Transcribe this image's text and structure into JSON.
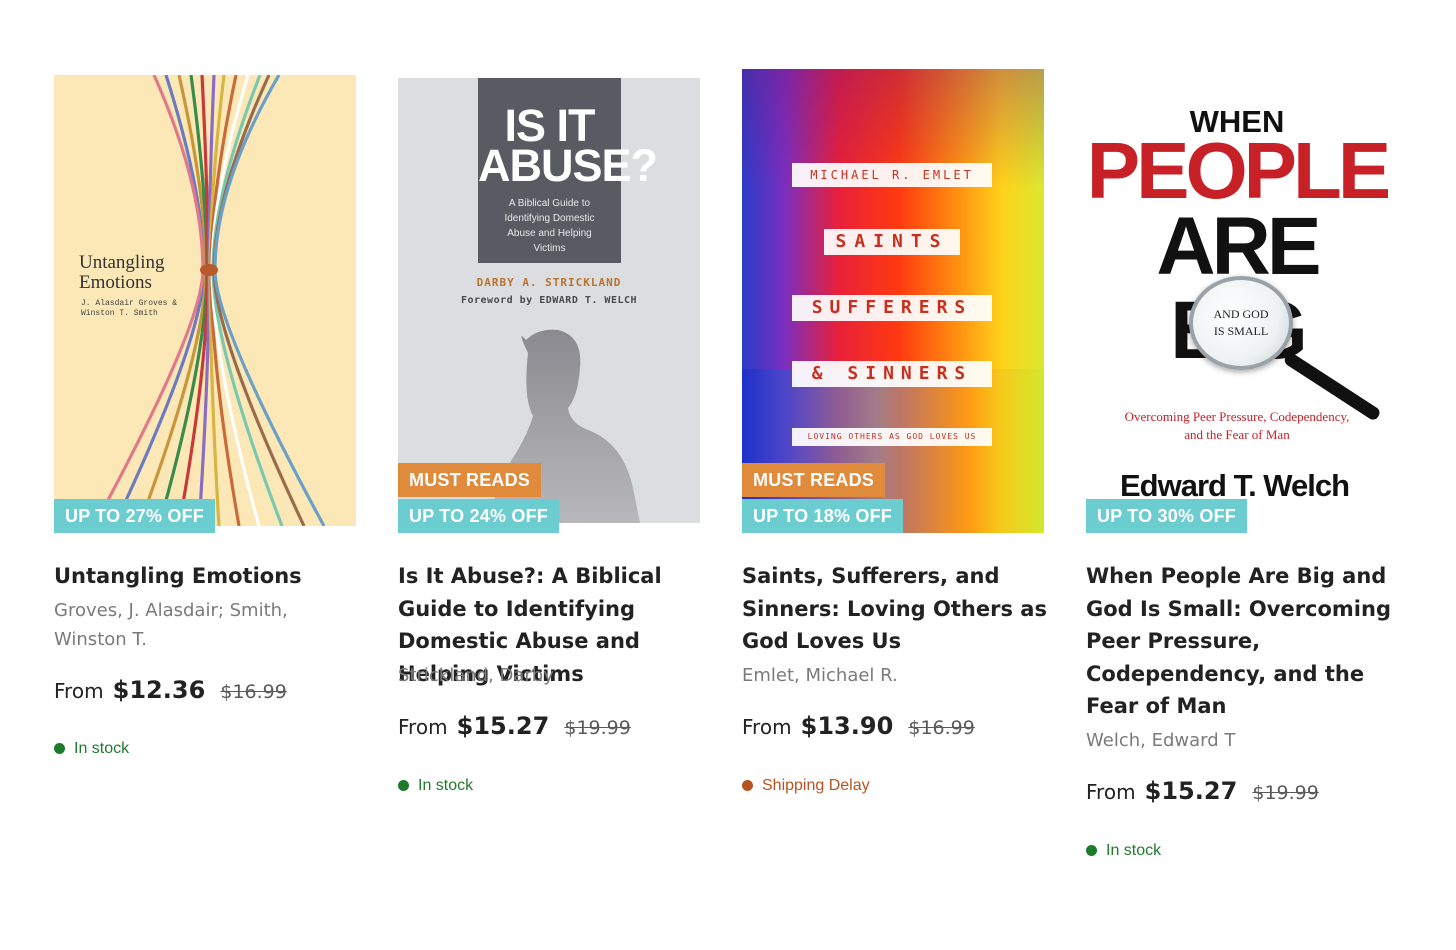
{
  "products": [
    {
      "title": "Untangling Emotions",
      "author": "Groves, J. Alasdair; Smith, Winston T.",
      "price_from": "From",
      "price": "$12.36",
      "price_was": "$16.99",
      "stock": "In stock",
      "stock_color": "#1f7a2e",
      "badge_off": "UP TO 27% OFF",
      "cover": {
        "title": "Untangling Emotions",
        "authors": "J. Alasdair Groves & Winston T. Smith",
        "bg": "#fce8b6"
      }
    },
    {
      "title": "Is It Abuse?: A Biblical Guide to Identifying Domestic Abuse and Helping Victims",
      "author": "Strickland, Darby",
      "price_from": "From",
      "price": "$15.27",
      "price_was": "$19.99",
      "stock": "In stock",
      "stock_color": "#1f7a2e",
      "badge_must": "MUST READS",
      "badge_off": "UP TO 24% OFF",
      "cover": {
        "title": "IS IT ABUSE?",
        "subtitle": "A Biblical Guide to Identifying Domestic Abuse and Helping Victims",
        "author": "DARBY A. STRICKLAND",
        "foreword": "Foreword by EDWARD T. WELCH"
      }
    },
    {
      "title": "Saints, Sufferers, and Sinners: Loving Others as God Loves Us",
      "author": "Emlet, Michael R.",
      "price_from": "From",
      "price": "$13.90",
      "price_was": "$16.99",
      "stock": "Shipping Delay",
      "stock_color": "#b8531f",
      "badge_must": "MUST READS",
      "badge_off": "UP TO 18% OFF",
      "cover": {
        "author": "MICHAEL R. EMLET",
        "line1": "SAINTS",
        "line2": "SUFFERERS",
        "line3": "& SINNERS",
        "tagline": "LOVING OTHERS AS GOD LOVES US"
      }
    },
    {
      "title": "When People Are Big and God Is Small: Overcoming Peer Pressure, Codependency, and the Fear of Man",
      "author": "Welch, Edward T",
      "price_from": "From",
      "price": "$15.27",
      "price_was": "$19.99",
      "stock": "In stock",
      "stock_color": "#1f7a2e",
      "badge_off": "UP TO 30% OFF",
      "cover": {
        "when": "WHEN",
        "people": "PEOPLE",
        "are_big": "ARE BIG",
        "lens": "AND GOD IS SMALL",
        "tagline": "Overcoming Peer Pressure, Codependency, and the Fear of Man",
        "author": "Edward T. Welch"
      }
    }
  ],
  "colors": {
    "badge_off": "#6ccdd0",
    "badge_must": "#e08a3c",
    "in_stock": "#1f7a2e",
    "shipping_delay": "#b8531f"
  }
}
